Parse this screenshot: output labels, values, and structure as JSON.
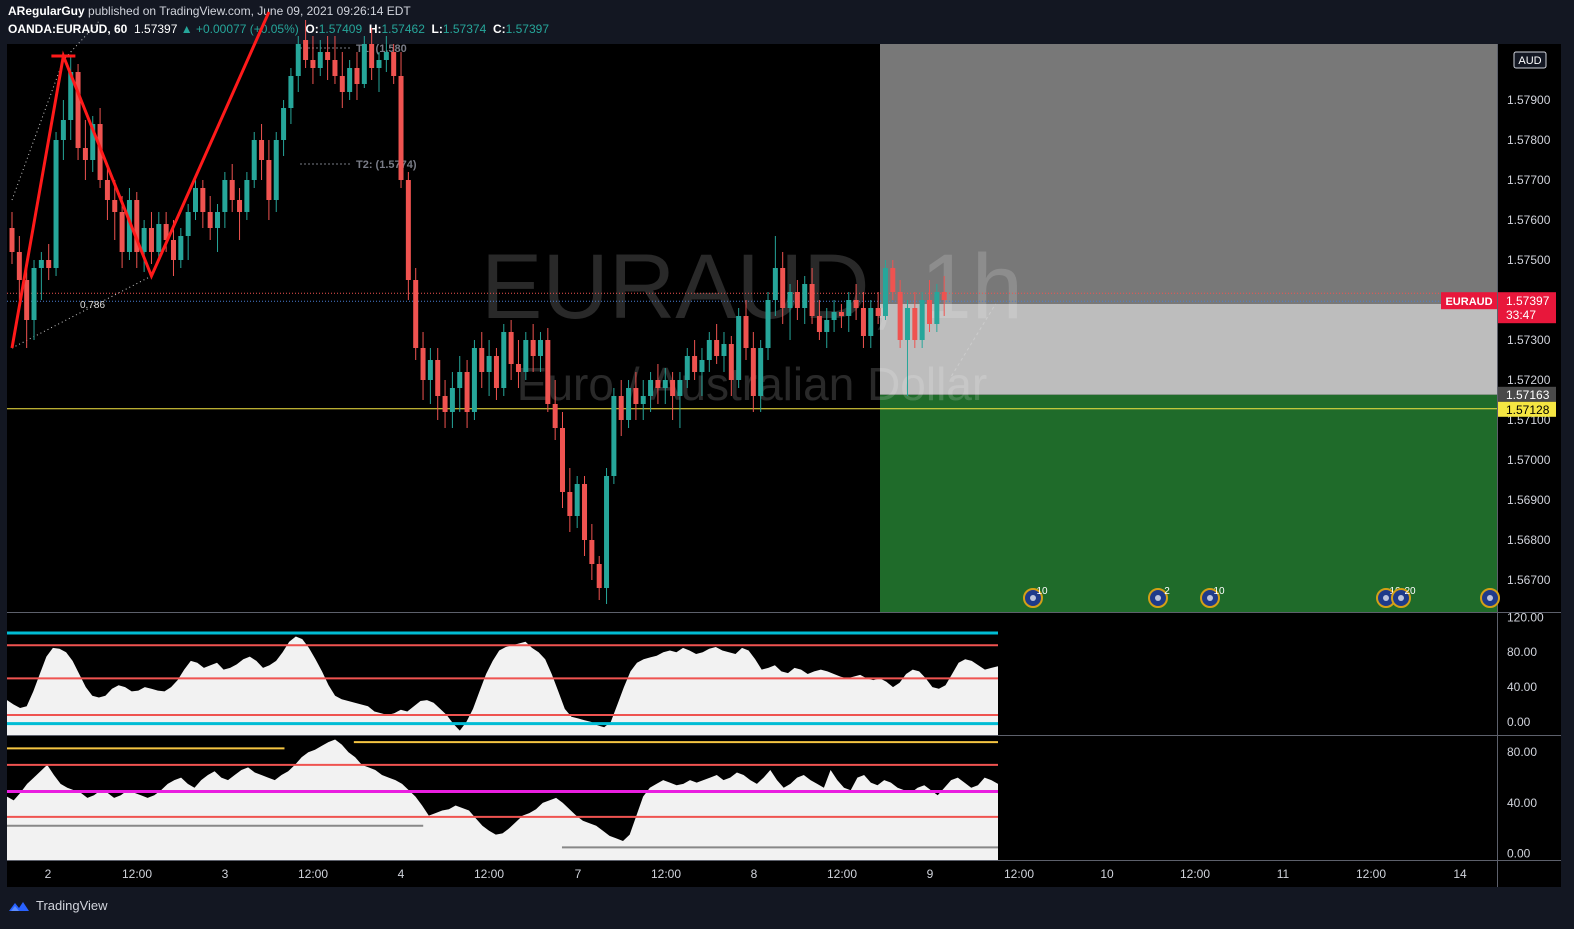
{
  "header": {
    "author": "ARegularGuy",
    "published": "published on TradingView.com, June 09, 2021 09:26:14 EDT",
    "symbol": "OANDA:EURAUD, 60",
    "last": "1.57397",
    "change": "+0.00077 (+0.05%)",
    "o_label": "O:",
    "o": "1.57409",
    "h_label": "H:",
    "h": "1.57462",
    "l_label": "L:",
    "l": "1.57374",
    "c_label": "C:",
    "c": "1.57397"
  },
  "footer": {
    "brand": "TradingView"
  },
  "colors": {
    "background": "#000000",
    "up": "#26a69a",
    "down": "#ef5350",
    "pattern": "#ff1a1a",
    "stop_zone": "#787878",
    "entry_zone": "#bdbdbd",
    "target_zone": "#1f6b2a",
    "support_line": "#f5e642",
    "price_label": "#e8173b",
    "cyan": "#00bcd4",
    "magenta": "#e91ee0"
  },
  "chart_data": {
    "type": "candlestick",
    "symbol_watermark": "EURAUD, 1h",
    "symbol_subtitle": "Euro / Australian Dollar",
    "currency": "AUD",
    "y_range": [
      1.5662,
      1.5804
    ],
    "y_ticks": [
      "1.57900",
      "1.57800",
      "1.57700",
      "1.57600",
      "1.57500",
      "1.57300",
      "1.57200",
      "1.57100",
      "1.57000",
      "1.56900",
      "1.56800",
      "1.56700"
    ],
    "x_ticks": [
      "2",
      "12:00",
      "3",
      "12:00",
      "4",
      "12:00",
      "7",
      "12:00",
      "8",
      "12:00",
      "9",
      "12:00",
      "10",
      "12:00",
      "11",
      "12:00",
      "14"
    ],
    "current_price": {
      "symbol": "EURAUD",
      "value": "1.57397",
      "countdown": "33:47"
    },
    "support_level": "1.57128",
    "zone_boundary": "1.57163",
    "fib_label": "0.786",
    "targets": [
      {
        "label": "T1: (1.580",
        "value": 1.5803
      },
      {
        "label": "T2: (1.5774)",
        "value": 1.5774
      }
    ],
    "pattern_points": [
      {
        "t": 0,
        "p": 1.5728
      },
      {
        "t": 7,
        "p": 1.5801
      },
      {
        "t": 19,
        "p": 1.5746
      },
      {
        "t": 35,
        "p": 1.5812
      }
    ],
    "zones": {
      "stop_top": 1.5806,
      "entry": 1.5739,
      "stop_bottom": 1.5739,
      "target_top": 1.57163,
      "target_bottom": 1.5662
    },
    "event_markers": [
      {
        "label": "10"
      },
      {
        "label": "2"
      },
      {
        "label": "10"
      },
      {
        "label": "10"
      },
      {
        "label": "20"
      },
      {
        "label": ""
      }
    ],
    "ohlc": [
      [
        1.5758,
        1.5762,
        1.5749,
        1.5752
      ],
      [
        1.5752,
        1.5756,
        1.574,
        1.5745
      ],
      [
        1.5745,
        1.575,
        1.5728,
        1.5735
      ],
      [
        1.5735,
        1.575,
        1.573,
        1.5748
      ],
      [
        1.5748,
        1.5752,
        1.574,
        1.575
      ],
      [
        1.575,
        1.5754,
        1.5745,
        1.5748
      ],
      [
        1.5748,
        1.5782,
        1.5746,
        1.578
      ],
      [
        1.578,
        1.579,
        1.5775,
        1.5785
      ],
      [
        1.5785,
        1.5801,
        1.578,
        1.5797
      ],
      [
        1.5797,
        1.5799,
        1.5775,
        1.5778
      ],
      [
        1.5778,
        1.5785,
        1.577,
        1.5775
      ],
      [
        1.5775,
        1.5786,
        1.5772,
        1.5784
      ],
      [
        1.5784,
        1.5788,
        1.5768,
        1.577
      ],
      [
        1.577,
        1.5774,
        1.576,
        1.5765
      ],
      [
        1.5765,
        1.577,
        1.5755,
        1.5762
      ],
      [
        1.5762,
        1.5766,
        1.5748,
        1.5752
      ],
      [
        1.5752,
        1.5768,
        1.575,
        1.5765
      ],
      [
        1.5765,
        1.5767,
        1.5748,
        1.5752
      ],
      [
        1.5752,
        1.576,
        1.5747,
        1.5758
      ],
      [
        1.5758,
        1.5762,
        1.5749,
        1.5752
      ],
      [
        1.5752,
        1.5762,
        1.575,
        1.5759
      ],
      [
        1.5759,
        1.5762,
        1.5752,
        1.5755
      ],
      [
        1.5755,
        1.576,
        1.5746,
        1.575
      ],
      [
        1.575,
        1.5758,
        1.5748,
        1.5756
      ],
      [
        1.5756,
        1.5764,
        1.575,
        1.5762
      ],
      [
        1.5762,
        1.577,
        1.576,
        1.5768
      ],
      [
        1.5768,
        1.577,
        1.5758,
        1.5762
      ],
      [
        1.5762,
        1.5766,
        1.5755,
        1.5758
      ],
      [
        1.5758,
        1.5764,
        1.5752,
        1.5762
      ],
      [
        1.5762,
        1.5772,
        1.5758,
        1.577
      ],
      [
        1.577,
        1.5774,
        1.5762,
        1.5765
      ],
      [
        1.5765,
        1.5768,
        1.5755,
        1.5762
      ],
      [
        1.5762,
        1.5772,
        1.576,
        1.577
      ],
      [
        1.577,
        1.5782,
        1.5768,
        1.578
      ],
      [
        1.578,
        1.5784,
        1.577,
        1.5775
      ],
      [
        1.5775,
        1.578,
        1.576,
        1.5765
      ],
      [
        1.5765,
        1.5782,
        1.5762,
        1.578
      ],
      [
        1.578,
        1.579,
        1.5776,
        1.5788
      ],
      [
        1.5788,
        1.5798,
        1.5784,
        1.5796
      ],
      [
        1.5796,
        1.5806,
        1.5792,
        1.5804
      ],
      [
        1.5805,
        1.581,
        1.5798,
        1.58
      ],
      [
        1.58,
        1.5806,
        1.5794,
        1.5798
      ],
      [
        1.5798,
        1.5805,
        1.5796,
        1.5802
      ],
      [
        1.5802,
        1.5806,
        1.5795,
        1.58
      ],
      [
        1.58,
        1.5806,
        1.5794,
        1.5796
      ],
      [
        1.5796,
        1.5802,
        1.5788,
        1.5792
      ],
      [
        1.5792,
        1.58,
        1.579,
        1.5798
      ],
      [
        1.5798,
        1.5802,
        1.579,
        1.5794
      ],
      [
        1.5794,
        1.5806,
        1.5793,
        1.5804
      ],
      [
        1.5804,
        1.5808,
        1.5795,
        1.5798
      ],
      [
        1.5798,
        1.5802,
        1.5792,
        1.58
      ],
      [
        1.58,
        1.5806,
        1.5797,
        1.5802
      ],
      [
        1.5802,
        1.5804,
        1.5794,
        1.5796
      ],
      [
        1.5796,
        1.5802,
        1.5768,
        1.577
      ],
      [
        1.577,
        1.5772,
        1.574,
        1.5745
      ],
      [
        1.5745,
        1.5748,
        1.5725,
        1.5728
      ],
      [
        1.5728,
        1.5732,
        1.5715,
        1.572
      ],
      [
        1.572,
        1.5728,
        1.5714,
        1.5725
      ],
      [
        1.5725,
        1.5728,
        1.571,
        1.5716
      ],
      [
        1.5716,
        1.572,
        1.5708,
        1.5712
      ],
      [
        1.5712,
        1.5722,
        1.5708,
        1.5718
      ],
      [
        1.5718,
        1.5726,
        1.5712,
        1.5722
      ],
      [
        1.5722,
        1.5725,
        1.5708,
        1.5712
      ],
      [
        1.5712,
        1.573,
        1.571,
        1.5728
      ],
      [
        1.5728,
        1.5732,
        1.5718,
        1.5722
      ],
      [
        1.5722,
        1.573,
        1.5716,
        1.5726
      ],
      [
        1.5726,
        1.5728,
        1.5715,
        1.5718
      ],
      [
        1.5718,
        1.5734,
        1.5716,
        1.5732
      ],
      [
        1.5732,
        1.5735,
        1.572,
        1.5724
      ],
      [
        1.5724,
        1.573,
        1.5718,
        1.5722
      ],
      [
        1.5722,
        1.5732,
        1.572,
        1.573
      ],
      [
        1.573,
        1.5734,
        1.5722,
        1.5726
      ],
      [
        1.5726,
        1.5732,
        1.5722,
        1.573
      ],
      [
        1.573,
        1.5733,
        1.5712,
        1.5714
      ],
      [
        1.5714,
        1.572,
        1.5705,
        1.5708
      ],
      [
        1.5708,
        1.5712,
        1.5688,
        1.5692
      ],
      [
        1.5692,
        1.5698,
        1.5682,
        1.5686
      ],
      [
        1.5686,
        1.5696,
        1.5683,
        1.5694
      ],
      [
        1.5694,
        1.5696,
        1.5676,
        1.568
      ],
      [
        1.568,
        1.5684,
        1.567,
        1.5674
      ],
      [
        1.5674,
        1.5676,
        1.5665,
        1.5668
      ],
      [
        1.5668,
        1.5698,
        1.5664,
        1.5696
      ],
      [
        1.5696,
        1.5718,
        1.5694,
        1.5716
      ],
      [
        1.5716,
        1.572,
        1.5706,
        1.571
      ],
      [
        1.571,
        1.572,
        1.5708,
        1.5718
      ],
      [
        1.5718,
        1.5722,
        1.571,
        1.5714
      ],
      [
        1.5714,
        1.572,
        1.571,
        1.5716
      ],
      [
        1.5716,
        1.5722,
        1.5712,
        1.572
      ],
      [
        1.572,
        1.5724,
        1.5714,
        1.5718
      ],
      [
        1.5718,
        1.5723,
        1.5714,
        1.572
      ],
      [
        1.572,
        1.5722,
        1.571,
        1.5716
      ],
      [
        1.5716,
        1.5722,
        1.5708,
        1.572
      ],
      [
        1.572,
        1.5728,
        1.5718,
        1.5726
      ],
      [
        1.5726,
        1.573,
        1.572,
        1.5722
      ],
      [
        1.5722,
        1.5728,
        1.5716,
        1.5725
      ],
      [
        1.5725,
        1.5732,
        1.5722,
        1.573
      ],
      [
        1.573,
        1.5734,
        1.5724,
        1.5726
      ],
      [
        1.5726,
        1.5732,
        1.5722,
        1.5729
      ],
      [
        1.5729,
        1.5731,
        1.5716,
        1.572
      ],
      [
        1.572,
        1.5738,
        1.5718,
        1.5736
      ],
      [
        1.5736,
        1.574,
        1.5725,
        1.5728
      ],
      [
        1.5728,
        1.5732,
        1.5712,
        1.5716
      ],
      [
        1.5716,
        1.573,
        1.5712,
        1.5728
      ],
      [
        1.5728,
        1.5742,
        1.5725,
        1.574
      ],
      [
        1.574,
        1.5756,
        1.5736,
        1.5748
      ],
      [
        1.5748,
        1.5752,
        1.5734,
        1.5738
      ],
      [
        1.5738,
        1.5744,
        1.573,
        1.5742
      ],
      [
        1.5742,
        1.5745,
        1.5735,
        1.5738
      ],
      [
        1.5738,
        1.5746,
        1.5734,
        1.5744
      ],
      [
        1.5744,
        1.5748,
        1.5734,
        1.5736
      ],
      [
        1.5736,
        1.574,
        1.573,
        1.5732
      ],
      [
        1.5732,
        1.5738,
        1.5728,
        1.5735
      ],
      [
        1.5735,
        1.574,
        1.5732,
        1.5737
      ],
      [
        1.5737,
        1.5739,
        1.5733,
        1.5736
      ],
      [
        1.5736,
        1.5742,
        1.5732,
        1.574
      ],
      [
        1.574,
        1.5744,
        1.5735,
        1.5738
      ],
      [
        1.5738,
        1.5742,
        1.5728,
        1.5731
      ],
      [
        1.5731,
        1.574,
        1.5728,
        1.5738
      ],
      [
        1.5738,
        1.5742,
        1.5734,
        1.5736
      ],
      [
        1.5736,
        1.575,
        1.5735,
        1.5748
      ],
      [
        1.5748,
        1.575,
        1.574,
        1.5742
      ],
      [
        1.5742,
        1.5745,
        1.5728,
        1.573
      ],
      [
        1.573,
        1.574,
        1.5716,
        1.5738
      ],
      [
        1.5738,
        1.5742,
        1.5728,
        1.573
      ],
      [
        1.573,
        1.5742,
        1.5728,
        1.574
      ],
      [
        1.574,
        1.5745,
        1.5732,
        1.5734
      ],
      [
        1.5734,
        1.5744,
        1.5732,
        1.5742
      ],
      [
        1.5742,
        1.5746,
        1.5736,
        1.574
      ]
    ]
  },
  "oscillator1": {
    "axis_ticks": [
      "120.00",
      "80.00",
      "40.00",
      "0.00"
    ],
    "range": [
      -15,
      125
    ],
    "levels": [
      {
        "value": 102,
        "color": "#00bcd4"
      },
      {
        "value": 88,
        "color": "#ef5350"
      },
      {
        "value": 50,
        "color": "#ef5350"
      },
      {
        "value": 8,
        "color": "#ef5350"
      },
      {
        "value": -2,
        "color": "#00bcd4"
      }
    ],
    "values": [
      25,
      20,
      16,
      18,
      35,
      55,
      75,
      85,
      84,
      80,
      70,
      55,
      40,
      30,
      28,
      30,
      38,
      42,
      40,
      35,
      36,
      40,
      38,
      36,
      35,
      40,
      48,
      60,
      70,
      68,
      62,
      65,
      68,
      60,
      62,
      66,
      72,
      75,
      70,
      62,
      65,
      70,
      80,
      92,
      98,
      95,
      85,
      72,
      58,
      42,
      30,
      26,
      24,
      22,
      20,
      18,
      12,
      10,
      8,
      10,
      14,
      12,
      18,
      24,
      25,
      22,
      15,
      8,
      -2,
      -10,
      0,
      15,
      35,
      55,
      70,
      82,
      86,
      88,
      90,
      92,
      85,
      80,
      72,
      55,
      35,
      15,
      6,
      4,
      2,
      0,
      -4,
      -6,
      0,
      20,
      40,
      58,
      68,
      72,
      74,
      76,
      80,
      82,
      80,
      85,
      82,
      78,
      80,
      84,
      86,
      82,
      80,
      78,
      85,
      82,
      72,
      60,
      62,
      65,
      58,
      56,
      62,
      60,
      55,
      58,
      60,
      58,
      55,
      52,
      50,
      52,
      54,
      50,
      48,
      50,
      46,
      40,
      45,
      55,
      60,
      58,
      50,
      40,
      38,
      42,
      55,
      68,
      72,
      70,
      65,
      60,
      62,
      64
    ]
  },
  "oscillator2": {
    "axis_ticks": [
      "80.00",
      "40.00",
      "0.00"
    ],
    "range": [
      -5,
      92
    ],
    "levels": [
      {
        "value": 83,
        "color": "#f5c542",
        "segment": [
          0,
          0.28
        ]
      },
      {
        "value": 88,
        "color": "#f5c542",
        "segment": [
          0.35,
          1.0
        ]
      },
      {
        "value": 70,
        "color": "#ef5350",
        "segment": [
          0,
          1.0
        ]
      },
      {
        "value": 49,
        "color": "#e91ee0",
        "segment": [
          0,
          1.0
        ]
      },
      {
        "value": 29,
        "color": "#ef5350",
        "segment": [
          0,
          1.0
        ]
      },
      {
        "value": 22,
        "color": "#888888",
        "segment": [
          0,
          0.42
        ]
      },
      {
        "value": 5,
        "color": "#888888",
        "segment": [
          0.56,
          1.0
        ]
      }
    ],
    "values": [
      45,
      42,
      48,
      55,
      60,
      65,
      70,
      62,
      55,
      52,
      50,
      48,
      44,
      46,
      50,
      48,
      44,
      46,
      50,
      48,
      46,
      44,
      46,
      50,
      55,
      58,
      60,
      55,
      52,
      58,
      62,
      65,
      60,
      58,
      62,
      66,
      68,
      64,
      62,
      60,
      58,
      62,
      65,
      70,
      76,
      80,
      82,
      85,
      88,
      90,
      86,
      80,
      76,
      70,
      68,
      66,
      62,
      60,
      58,
      55,
      50,
      45,
      38,
      30,
      32,
      34,
      35,
      38,
      36,
      34,
      28,
      22,
      18,
      15,
      16,
      20,
      25,
      30,
      32,
      35,
      40,
      42,
      44,
      40,
      35,
      30,
      26,
      24,
      22,
      18,
      14,
      12,
      10,
      15,
      30,
      45,
      52,
      55,
      58,
      56,
      54,
      55,
      58,
      56,
      58,
      60,
      62,
      58,
      60,
      64,
      62,
      58,
      55,
      60,
      66,
      58,
      52,
      55,
      60,
      62,
      58,
      55,
      52,
      66,
      58,
      52,
      50,
      60,
      62,
      56,
      54,
      58,
      56,
      52,
      50,
      48,
      52,
      54,
      50,
      46,
      52,
      58,
      60,
      56,
      52,
      54,
      60,
      58,
      55
    ]
  }
}
